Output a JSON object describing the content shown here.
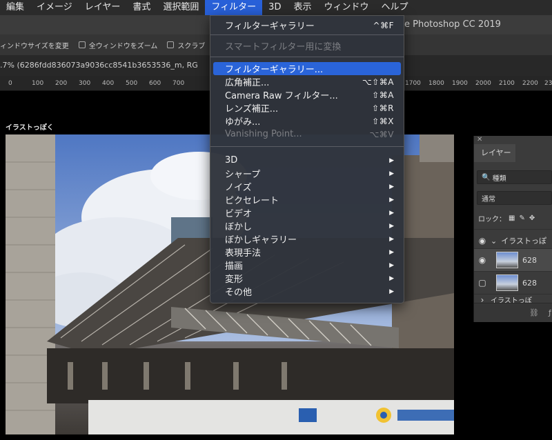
{
  "menubar": {
    "items": [
      "編集",
      "イメージ",
      "レイヤー",
      "書式",
      "選択範囲",
      "フィルター",
      "3D",
      "表示",
      "ウィンドウ",
      "ヘルプ"
    ],
    "active_index": 5
  },
  "app_title": "e Photoshop CC 2019",
  "options": {
    "resize_windows": "ィンドウサイズを変更",
    "zoom_all": "全ウィンドウをズーム",
    "scrubby": "スクラブ"
  },
  "document_tab": ".7% (6286fdd836073a9036cc8541b3653536_m, RG",
  "ruler_ticks": [
    "0",
    "100",
    "200",
    "300",
    "400",
    "500",
    "600",
    "700",
    "1700",
    "1800",
    "1900",
    "2000",
    "2100",
    "2200",
    "23"
  ],
  "layer_name_label": "イラストっぽく",
  "filter_menu": {
    "top_item": {
      "label": "フィルターギャラリー",
      "shortcut": "^⌘F"
    },
    "smart_filter": {
      "label": "スマートフィルター用に変換"
    },
    "group1": [
      {
        "label": "フィルターギャラリー...",
        "shortcut": ""
      },
      {
        "label": "広角補正...",
        "shortcut": "⌥⇧⌘A"
      },
      {
        "label": "Camera Raw フィルター...",
        "shortcut": "⇧⌘A"
      },
      {
        "label": "レンズ補正...",
        "shortcut": "⇧⌘R"
      },
      {
        "label": "ゆがみ...",
        "shortcut": "⇧⌘X"
      },
      {
        "label": "Vanishing Point...",
        "shortcut": "⌥⌘V"
      }
    ],
    "group2": [
      "3D",
      "シャープ",
      "ノイズ",
      "ピクセレート",
      "ビデオ",
      "ぼかし",
      "ぼかしギャラリー",
      "表現手法",
      "描画",
      "変形",
      "その他"
    ],
    "submenu_arrow": "▶"
  },
  "layers_panel": {
    "tab": "レイヤー",
    "search": "種類",
    "blend_mode": "通常",
    "lock_label": "ロック：",
    "group_name": "イラストっぽ",
    "layer1": "628",
    "layer2": "628",
    "layer3": "イラストっぽ"
  }
}
